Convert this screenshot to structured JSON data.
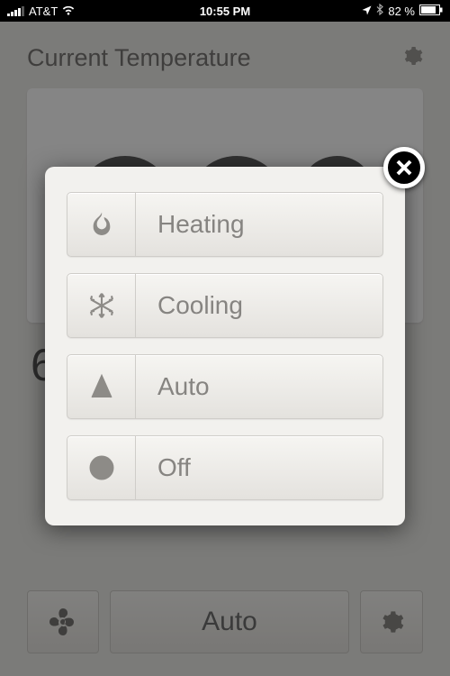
{
  "status_bar": {
    "carrier": "AT&T",
    "time": "10:55 PM",
    "battery": "82 %"
  },
  "header": {
    "title": "Current Temperature"
  },
  "bottom": {
    "mode": "Auto"
  },
  "modal": {
    "options": [
      {
        "icon": "flame-icon",
        "label": "Heating"
      },
      {
        "icon": "snowflake-icon",
        "label": "Cooling"
      },
      {
        "icon": "letter-a-icon",
        "label": "Auto"
      },
      {
        "icon": "prohibit-icon",
        "label": "Off"
      }
    ]
  }
}
